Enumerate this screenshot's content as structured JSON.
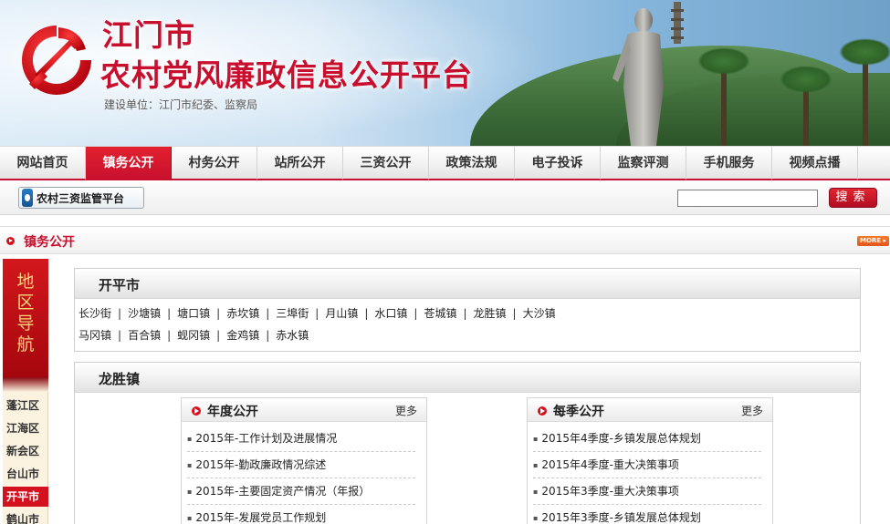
{
  "banner": {
    "title_line1": "江门市",
    "title_line2": "农村党风廉政信息公开平台",
    "builder": "建设单位：江门市纪委、监察局"
  },
  "nav": {
    "items": [
      {
        "label": "网站首页",
        "active": false
      },
      {
        "label": "镇务公开",
        "active": true
      },
      {
        "label": "村务公开",
        "active": false
      },
      {
        "label": "站所公开",
        "active": false
      },
      {
        "label": "三资公开",
        "active": false
      },
      {
        "label": "政策法规",
        "active": false
      },
      {
        "label": "电子投诉",
        "active": false
      },
      {
        "label": "监察评测",
        "active": false
      },
      {
        "label": "手机服务",
        "active": false
      },
      {
        "label": "视频点播",
        "active": false
      }
    ]
  },
  "toolbar": {
    "sanzi_label": "农村三资监管平台",
    "search_value": "",
    "search_button": "搜索"
  },
  "section": {
    "title": "镇务公开",
    "more": "MORE"
  },
  "region_nav": {
    "title": "地区导航",
    "items": [
      {
        "label": "蓬江区",
        "active": false
      },
      {
        "label": "江海区",
        "active": false
      },
      {
        "label": "新会区",
        "active": false
      },
      {
        "label": "台山市",
        "active": false
      },
      {
        "label": "开平市",
        "active": true
      },
      {
        "label": "鹤山市",
        "active": false
      }
    ]
  },
  "city_box": {
    "title": "开平市",
    "rows": [
      [
        "长沙街",
        "沙塘镇",
        "塘口镇",
        "赤坎镇",
        "三埠街",
        "月山镇",
        "水口镇",
        "苍城镇",
        "龙胜镇",
        "大沙镇"
      ],
      [
        "马冈镇",
        "百合镇",
        "蚬冈镇",
        "金鸡镇",
        "赤水镇"
      ]
    ]
  },
  "town_box": {
    "title": "龙胜镇",
    "panels": [
      {
        "title": "年度公开",
        "more": "更多",
        "items": [
          "2015年-工作计划及进展情况",
          "2015年-勤政廉政情况综述",
          "2015年-主要固定资产情况（年报）",
          "2015年-发展党员工作规划"
        ]
      },
      {
        "title": "每季公开",
        "more": "更多",
        "items": [
          "2015年4季度-乡镇发展总体规划",
          "2015年4季度-重大决策事项",
          "2015年3季度-重大决策事项",
          "2015年3季度-乡镇发展总体规划"
        ]
      }
    ]
  }
}
